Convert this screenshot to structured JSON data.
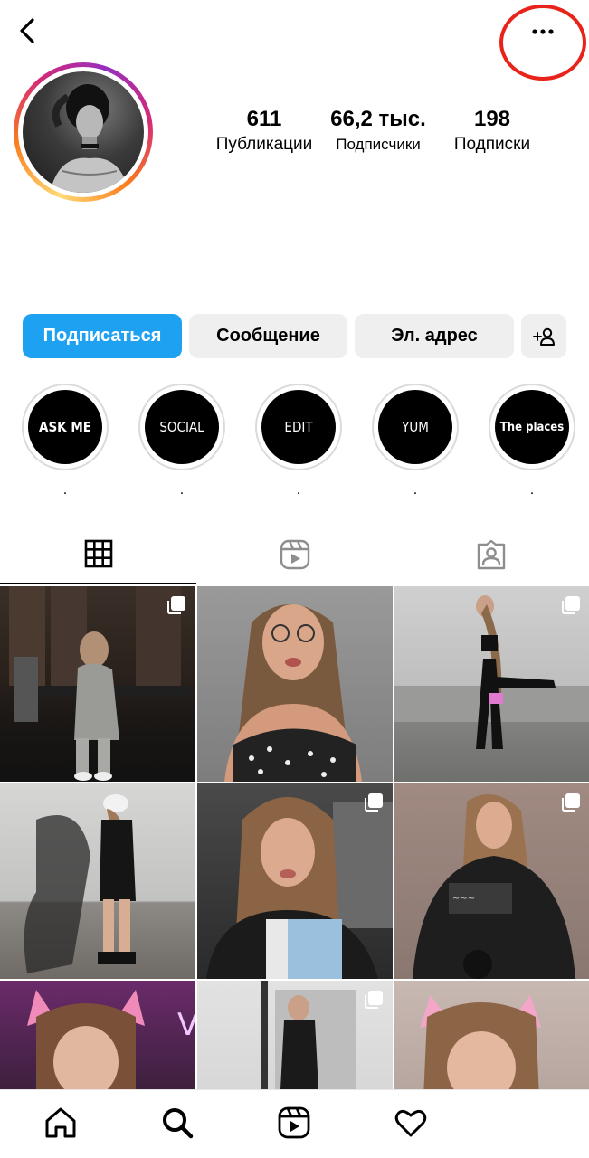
{
  "profile": {
    "stats": [
      {
        "value": "611",
        "label": "Публикации"
      },
      {
        "value": "66,2 тыс.",
        "label": "Подписчики"
      },
      {
        "value": "198",
        "label": "Подписки"
      }
    ]
  },
  "actions": {
    "follow": "Подписаться",
    "message": "Сообщение",
    "email": "Эл. адрес",
    "add_person_icon": "add-person-icon"
  },
  "highlights": [
    {
      "title": "ASK ME",
      "caption": "."
    },
    {
      "title": "SOCIAL",
      "caption": "."
    },
    {
      "title": "EDIT",
      "caption": "."
    },
    {
      "title": "YUM",
      "caption": "."
    },
    {
      "title": "The places",
      "caption": "."
    }
  ],
  "tabs": [
    {
      "icon": "grid-icon",
      "active": true
    },
    {
      "icon": "reels-icon",
      "active": false
    },
    {
      "icon": "tagged-icon",
      "active": false
    }
  ],
  "bottom_nav": [
    "home-icon",
    "search-icon",
    "reels-icon",
    "heart-icon"
  ],
  "colors": {
    "accent": "#1ea1f1",
    "button_gray": "#efefef",
    "annotation_circle": "#e8231a"
  }
}
